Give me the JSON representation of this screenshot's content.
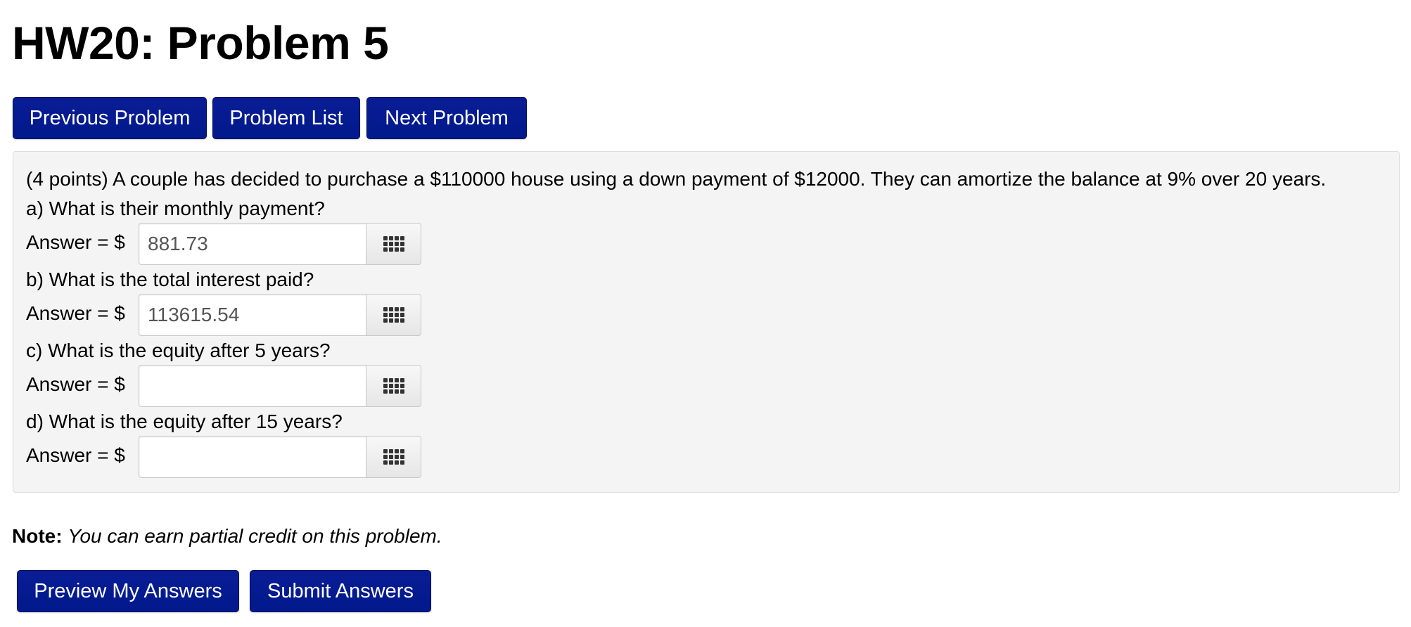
{
  "page": {
    "title": "HW20: Problem 5"
  },
  "nav": {
    "previous_label": "Previous Problem",
    "list_label": "Problem List",
    "next_label": "Next Problem"
  },
  "problem": {
    "statement": "(4 points) A couple has decided to purchase a $110000 house using a down payment of $12000. They can amortize the balance at 9% over 20 years.",
    "parts": [
      {
        "question": "a) What is their monthly payment?",
        "answer_label": "Answer = $",
        "value": "881.73",
        "icon": "keypad-icon"
      },
      {
        "question": "b) What is the total interest paid?",
        "answer_label": "Answer = $",
        "value": "113615.54",
        "icon": "keypad-icon"
      },
      {
        "question": "c) What is the equity after 5 years?",
        "answer_label": "Answer = $",
        "value": "",
        "icon": "keypad-icon"
      },
      {
        "question": "d) What is the equity after 15 years?",
        "answer_label": "Answer = $",
        "value": "",
        "icon": "keypad-icon"
      }
    ]
  },
  "note": {
    "label": "Note:",
    "text": "You can earn partial credit on this problem."
  },
  "actions": {
    "preview_label": "Preview My Answers",
    "submit_label": "Submit Answers"
  },
  "colors": {
    "button_bg": "#0b1d93",
    "panel_bg": "#f4f4f4"
  }
}
